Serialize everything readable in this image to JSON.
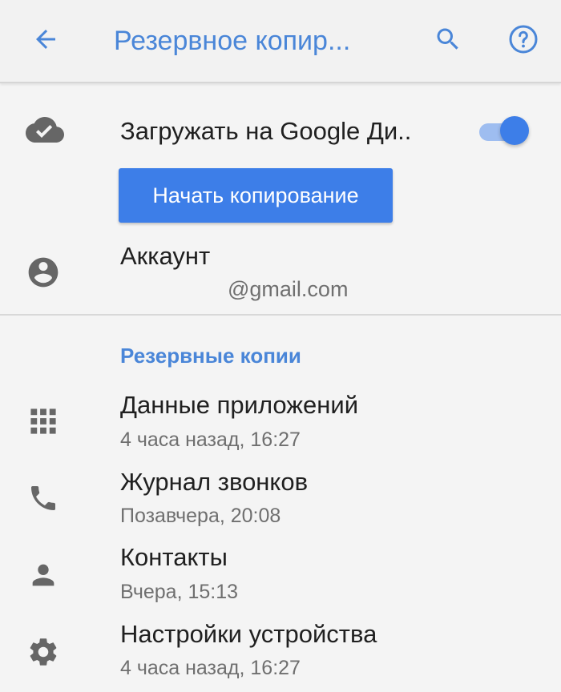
{
  "appbar": {
    "title": "Резервное копир...",
    "back_icon": "arrow-back-icon",
    "search_icon": "search-icon",
    "help_icon": "help-circle-icon"
  },
  "upload": {
    "label": "Загружать на Google Ди..",
    "icon": "cloud-done-icon",
    "toggle_on": true,
    "start_button_label": "Начать копирование"
  },
  "account": {
    "label": "Аккаунт",
    "email": "@gmail.com",
    "icon": "account-circle-icon"
  },
  "backups": {
    "header": "Резервные копии",
    "items": [
      {
        "title": "Данные приложений",
        "subtitle": "4 часа назад, 16:27",
        "icon": "apps-grid-icon"
      },
      {
        "title": "Журнал звонков",
        "subtitle": "Позавчера, 20:08",
        "icon": "phone-icon"
      },
      {
        "title": "Контакты",
        "subtitle": "Вчера, 15:13",
        "icon": "person-icon"
      },
      {
        "title": "Настройки устройства",
        "subtitle": "4 часа назад, 16:27",
        "icon": "settings-gear-icon"
      }
    ]
  },
  "colors": {
    "accent": "#4a86d8",
    "button": "#3d7ee8",
    "icon_gray": "#666666",
    "background": "#f4f4f4"
  }
}
